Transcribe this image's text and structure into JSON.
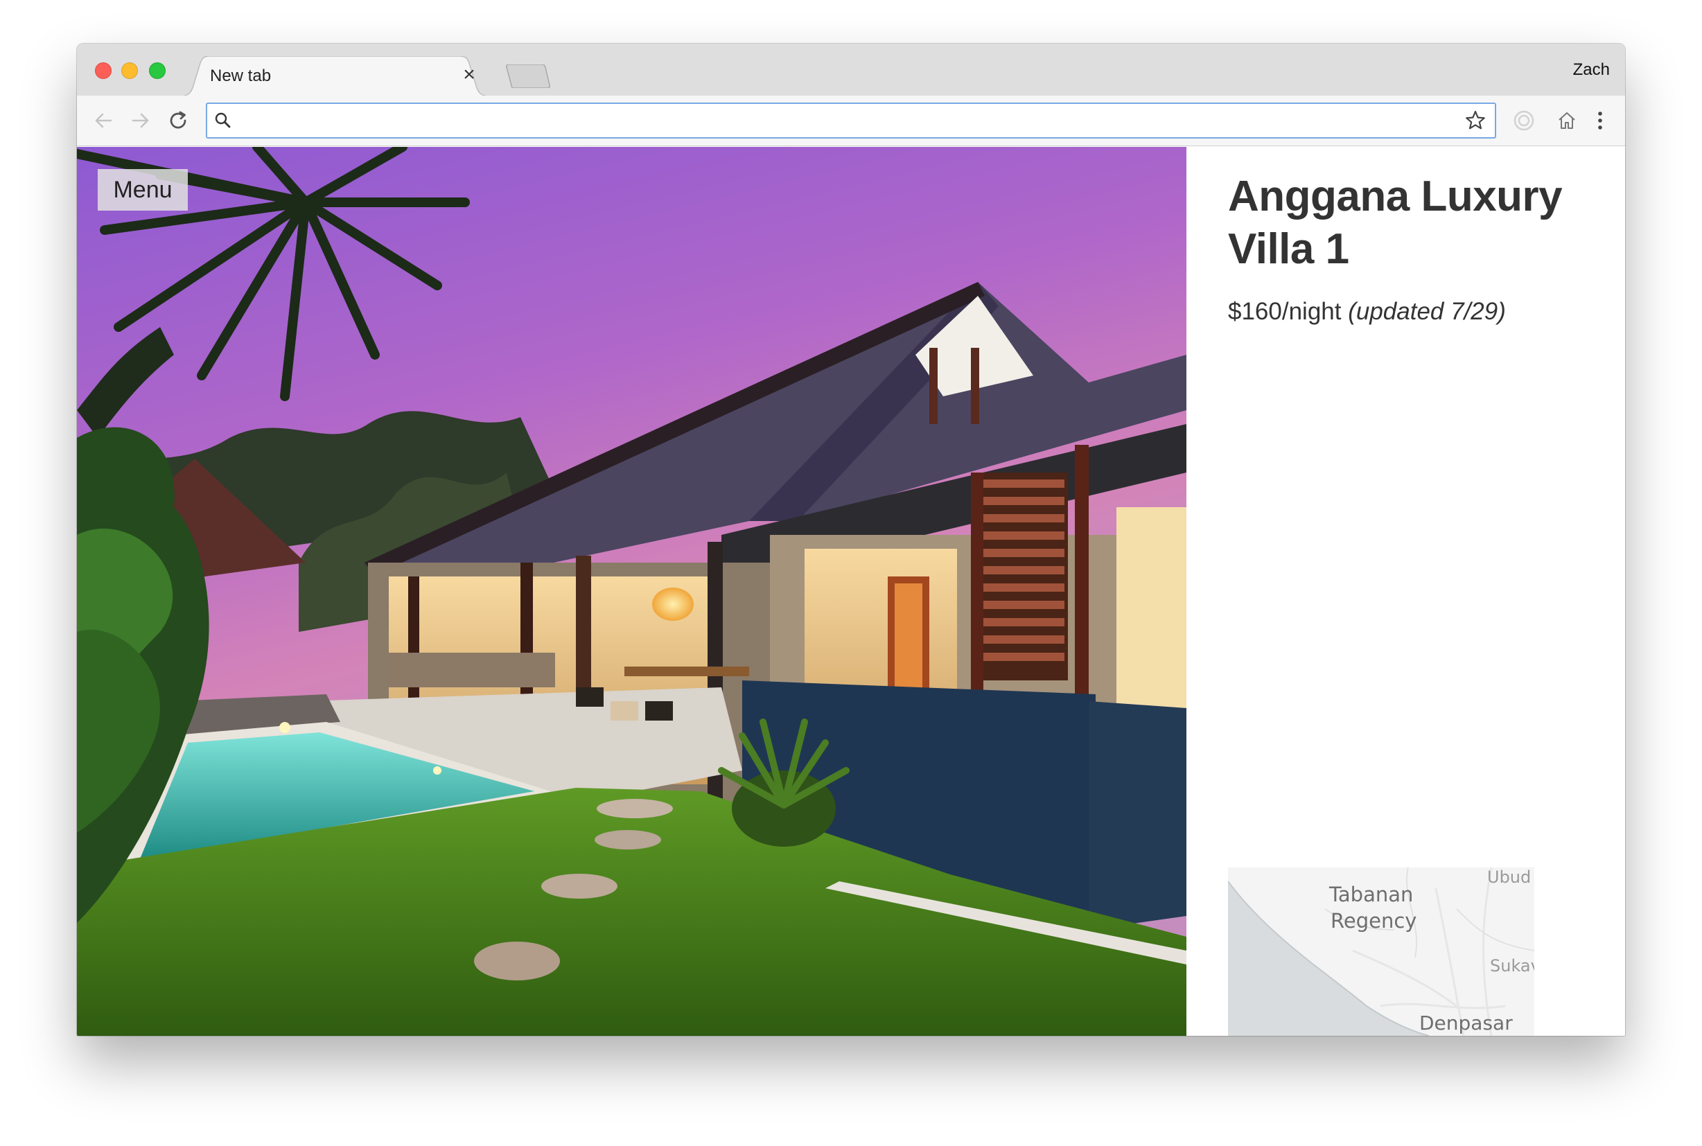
{
  "browser": {
    "tab_title": "New tab",
    "profile_name": "Zach",
    "address_value": "",
    "icons": {
      "back": "arrow-left-icon",
      "forward": "arrow-right-icon",
      "reload": "reload-icon",
      "search": "search-icon",
      "bookmark": "star-icon",
      "extension": "extension-icon",
      "home": "home-icon",
      "menu": "kebab-menu-icon"
    }
  },
  "page": {
    "menu_label": "Menu",
    "listing": {
      "title": "Anggana Luxury Villa 1",
      "price": "$160/night",
      "updated": "(updated 7/29)"
    },
    "map": {
      "labels": [
        "Tabanan",
        "Regency",
        "Ubud",
        "Sukav",
        "Denpasar"
      ]
    }
  },
  "colors": {
    "accent_focus": "#78a8e2",
    "text_primary": "#333333",
    "traffic_close": "#fc5f57",
    "traffic_minimize": "#fdbc2e",
    "traffic_maximize": "#28c840"
  }
}
